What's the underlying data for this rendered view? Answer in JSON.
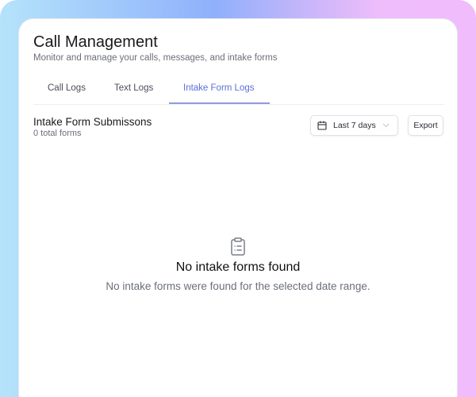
{
  "header": {
    "title": "Call Management",
    "subtitle": "Monitor and manage your calls, messages, and intake forms"
  },
  "tabs": [
    {
      "label": "Call Logs"
    },
    {
      "label": "Text Logs"
    },
    {
      "label": "Intake Form Logs",
      "active": true
    }
  ],
  "section": {
    "title": "Intake Form Submissons",
    "count": "0 total forms"
  },
  "filters": {
    "date_range": "Last 7 days",
    "export_label": "Export"
  },
  "empty_state": {
    "icon": "clipboard-list-icon",
    "title": "No intake forms found",
    "description": "No intake forms were found for the selected date range."
  },
  "colors": {
    "accent": "#5a6fd8"
  }
}
